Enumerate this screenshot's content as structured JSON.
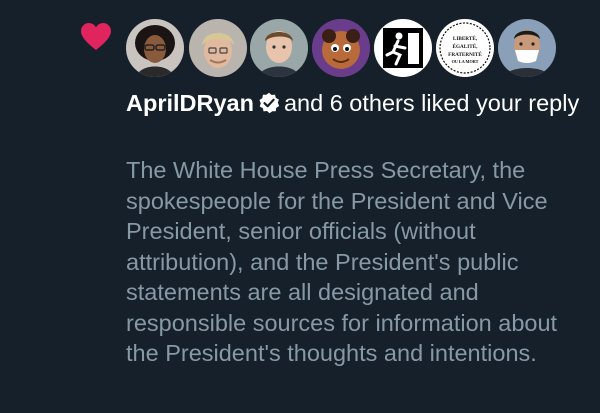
{
  "notification": {
    "type": "like",
    "heart_color": "#e0245e",
    "avatars": [
      {
        "name": "avatar-woman-glasses-icon"
      },
      {
        "name": "avatar-blond-man-icon"
      },
      {
        "name": "avatar-young-man-icon"
      },
      {
        "name": "avatar-cartoon-character-icon"
      },
      {
        "name": "avatar-exit-sign-icon"
      },
      {
        "name": "avatar-seal-logo-icon"
      },
      {
        "name": "avatar-man-mask-icon"
      }
    ],
    "seal_text": [
      "LIBERTÉ,",
      "ÉGALITÉ,",
      "FRATERNITÉ",
      "OU LA MORT"
    ],
    "username": "AprilDRyan",
    "verified_icon": "verified-badge-icon",
    "headline_rest": "and 6 others liked your reply",
    "reply_text": "The White House Press Secretary, the spokespeople for the President and Vice President, senior officials (without attribution), and the President's public statements are all designated and responsible sources for information about the President's thoughts and intentions."
  }
}
